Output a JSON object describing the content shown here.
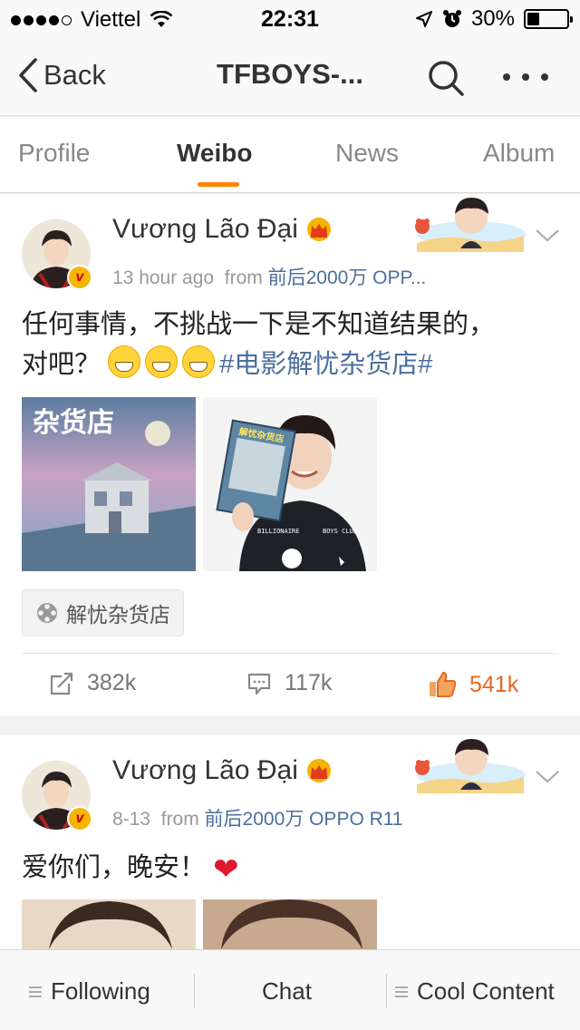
{
  "status_bar": {
    "carrier": "Viettel",
    "time": "22:31",
    "battery": "30%",
    "battery_level": 0.3
  },
  "nav": {
    "back_label": "Back",
    "title": "TFBOYS-..."
  },
  "tabs": [
    {
      "label": "Profile",
      "active": false
    },
    {
      "label": "Weibo",
      "active": true
    },
    {
      "label": "News",
      "active": false
    },
    {
      "label": "Album",
      "active": false
    }
  ],
  "posts": [
    {
      "username": "Vương Lão Đại",
      "time": "13 hour ago",
      "from_label": "from",
      "source": "前后2000万 OPP...",
      "text_line1": "任何事情，不挑战一下是不知道结果的，",
      "text_line2_prefix": "对吧？",
      "hashtag": "#电影解忧杂货店#",
      "emoji_count": 3,
      "poi_tag": "解忧杂货店",
      "reposts": "382k",
      "comments": "117k",
      "likes": "541k",
      "image1_text": "杂货店",
      "image2_book": "解忧杂货店",
      "image2_shirt1": "BILLIONAIRE",
      "image2_shirt2": "BOYS CLUB"
    },
    {
      "username": "Vương Lão Đại",
      "time": "8-13",
      "from_label": "from",
      "source": "前后2000万 OPPO R11",
      "text": "爱你们，晚安！"
    }
  ],
  "bottom_bar": {
    "following": "Following",
    "chat": "Chat",
    "cool_content": "Cool Content"
  },
  "colors": {
    "accent": "#ff8200",
    "link": "#4c6f9f",
    "liked": "#e86722",
    "heart": "#e0192e"
  }
}
